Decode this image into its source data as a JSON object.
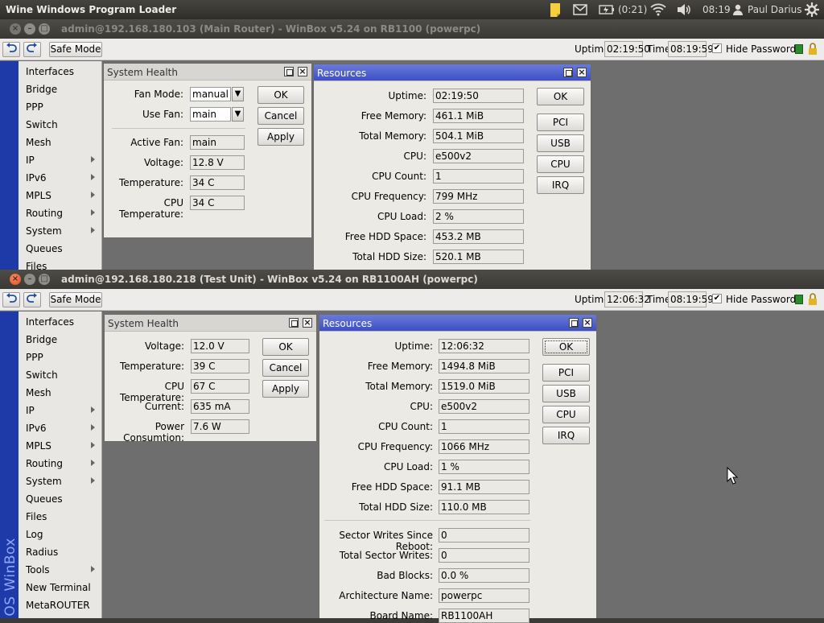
{
  "topbar": {
    "title": "Wine Windows Program Loader",
    "battery": "(0:21)",
    "clock": "08:19",
    "user": "Paul Darius"
  },
  "w1": {
    "title": "admin@192.168.180.103 (Main Router) - WinBox v5.24 on RB1100 (powerpc)",
    "toolbar": {
      "safe_mode": "Safe Mode",
      "uptime_label": "Uptime:",
      "uptime": "02:19:50",
      "time_label": "Time:",
      "time": "08:19:59",
      "hide_passwords": "Hide Passwords"
    },
    "menu": [
      "Interfaces",
      "Bridge",
      "PPP",
      "Switch",
      "Mesh",
      "IP",
      "IPv6",
      "MPLS",
      "Routing",
      "System",
      "Queues",
      "Files"
    ],
    "health": {
      "title": "System Health",
      "fan_mode_label": "Fan Mode:",
      "fan_mode": "manual",
      "use_fan_label": "Use Fan:",
      "use_fan": "main",
      "rows": [
        {
          "label": "Active Fan:",
          "value": "main"
        },
        {
          "label": "Voltage:",
          "value": "12.8 V"
        },
        {
          "label": "Temperature:",
          "value": "34 C"
        },
        {
          "label": "CPU Temperature:",
          "value": "34 C"
        }
      ],
      "buttons": [
        "OK",
        "Cancel",
        "Apply"
      ]
    },
    "resources": {
      "title": "Resources",
      "rows": [
        {
          "label": "Uptime:",
          "value": "02:19:50"
        },
        {
          "label": "Free Memory:",
          "value": "461.1 MiB"
        },
        {
          "label": "Total Memory:",
          "value": "504.1 MiB"
        },
        {
          "label": "CPU:",
          "value": "e500v2"
        },
        {
          "label": "CPU Count:",
          "value": "1"
        },
        {
          "label": "CPU Frequency:",
          "value": "799 MHz"
        },
        {
          "label": "CPU Load:",
          "value": "2 %"
        },
        {
          "label": "Free HDD Space:",
          "value": "453.2 MB"
        },
        {
          "label": "Total HDD Size:",
          "value": "520.1 MB"
        }
      ],
      "buttons": [
        "OK",
        "PCI",
        "USB",
        "CPU",
        "IRQ"
      ]
    }
  },
  "w2": {
    "title": "admin@192.168.180.218 (Test Unit) - WinBox v5.24 on RB1100AH (powerpc)",
    "toolbar": {
      "safe_mode": "Safe Mode",
      "uptime_label": "Uptime:",
      "uptime": "12:06:32",
      "time_label": "Time:",
      "time": "08:19:59",
      "hide_passwords": "Hide Passwords"
    },
    "vertical_text": "OS WinBox",
    "menu": [
      "Interfaces",
      "Bridge",
      "PPP",
      "Switch",
      "Mesh",
      "IP",
      "IPv6",
      "MPLS",
      "Routing",
      "System",
      "Queues",
      "Files",
      "Log",
      "Radius",
      "Tools",
      "New Terminal",
      "MetaROUTER"
    ],
    "health": {
      "title": "System Health",
      "rows": [
        {
          "label": "Voltage:",
          "value": "12.0 V"
        },
        {
          "label": "Temperature:",
          "value": "39 C"
        },
        {
          "label": "CPU Temperature:",
          "value": "67 C"
        },
        {
          "label": "Current:",
          "value": "635 mA"
        },
        {
          "label": "Power Consumtion:",
          "value": "7.6 W"
        }
      ],
      "buttons": [
        "OK",
        "Cancel",
        "Apply"
      ]
    },
    "resources": {
      "title": "Resources",
      "rows": [
        {
          "label": "Uptime:",
          "value": "12:06:32"
        },
        {
          "label": "Free Memory:",
          "value": "1494.8 MiB"
        },
        {
          "label": "Total Memory:",
          "value": "1519.0 MiB"
        },
        {
          "label": "CPU:",
          "value": "e500v2"
        },
        {
          "label": "CPU Count:",
          "value": "1"
        },
        {
          "label": "CPU Frequency:",
          "value": "1066 MHz"
        },
        {
          "label": "CPU Load:",
          "value": "1 %"
        },
        {
          "label": "Free HDD Space:",
          "value": "91.1 MB"
        },
        {
          "label": "Total HDD Size:",
          "value": "110.0 MB"
        }
      ],
      "rows2": [
        {
          "label": "Sector Writes Since Reboot:",
          "value": "0"
        },
        {
          "label": "Total Sector Writes:",
          "value": "0"
        },
        {
          "label": "Bad Blocks:",
          "value": "0.0 %"
        },
        {
          "label": "Architecture Name:",
          "value": "powerpc"
        },
        {
          "label": "Board Name:",
          "value": "RB1100AH"
        }
      ],
      "buttons": [
        "OK",
        "PCI",
        "USB",
        "CPU",
        "IRQ"
      ]
    }
  }
}
